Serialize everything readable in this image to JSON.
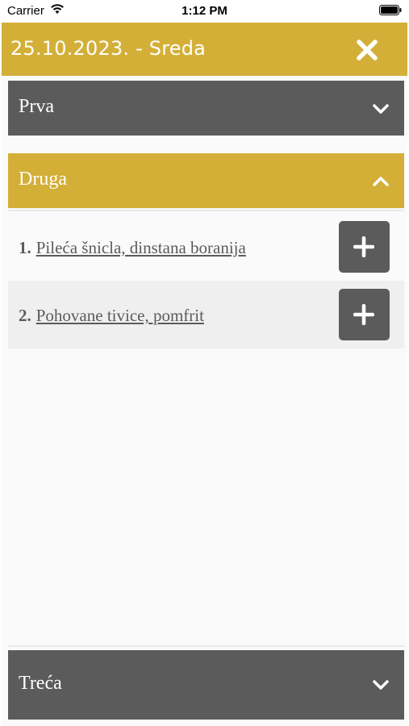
{
  "status_bar": {
    "carrier": "Carrier",
    "time": "1:12 PM"
  },
  "header": {
    "title": "25.10.2023. - Sreda"
  },
  "accordion": [
    {
      "label": "Prva",
      "expanded": false
    },
    {
      "label": "Druga",
      "expanded": true,
      "items": [
        {
          "number": "1.",
          "name": "Pileća šnicla, dinstana boranija"
        },
        {
          "number": "2.",
          "name": "Pohovane tivice, pomfrit"
        }
      ]
    },
    {
      "label": "Treća",
      "expanded": false
    }
  ],
  "colors": {
    "accent": "#d4af37",
    "dark": "#5b5b5b",
    "row_alt": "#efefef"
  },
  "icons": {
    "close": "close-icon",
    "collapsed": "chevron-down-icon",
    "expanded": "chevron-up-icon",
    "add": "plus-icon"
  }
}
